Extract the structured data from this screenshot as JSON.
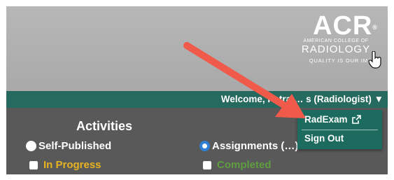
{
  "header": {
    "logo": {
      "acr": "ACR",
      "registered": "®",
      "line1": "AMERICAN COLLEGE OF",
      "line2": "RADIOLOGY",
      "tagline": "QUALITY IS OUR IMAGE"
    }
  },
  "welcome_bar": {
    "text": "Welcome, Petra … s (Radiologist) ▼"
  },
  "user_menu": {
    "items": [
      {
        "label": "RadExam",
        "icon": "external-link-icon"
      },
      {
        "label": "Sign Out"
      }
    ]
  },
  "activities": {
    "title": "Activities",
    "radios": [
      {
        "label": "Self-Published",
        "selected": false
      },
      {
        "label": "Assignments (…)",
        "selected": true
      }
    ],
    "filters": [
      {
        "label": "In Progress",
        "color": "#e8b320",
        "checked": false
      },
      {
        "label": "Completed",
        "color": "#5f9e3e",
        "checked": false
      }
    ]
  },
  "colors": {
    "header_bg": "#afafaf",
    "welcome_bar": "#26695e",
    "panel_bg": "#595959",
    "annotation_arrow": "#f05a4b"
  }
}
